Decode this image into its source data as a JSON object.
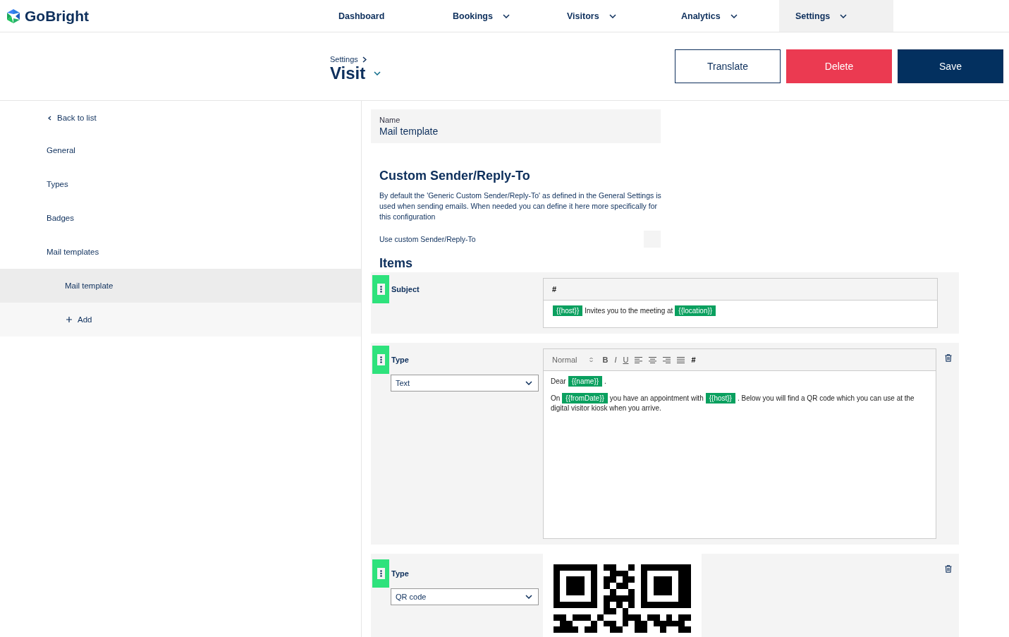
{
  "brand": {
    "name": "GoBright"
  },
  "nav": [
    {
      "label": "Dashboard",
      "dropdown": false,
      "selected": false
    },
    {
      "label": "Bookings",
      "dropdown": true,
      "selected": false
    },
    {
      "label": "Visitors",
      "dropdown": true,
      "selected": false
    },
    {
      "label": "Analytics",
      "dropdown": true,
      "selected": false
    },
    {
      "label": "Settings",
      "dropdown": true,
      "selected": true
    }
  ],
  "header": {
    "breadcrumb": "Settings",
    "title": "Visit",
    "buttons": [
      {
        "label": "Translate",
        "kind": "outline"
      },
      {
        "label": "Delete",
        "kind": "danger"
      },
      {
        "label": "Save",
        "kind": "primary"
      }
    ]
  },
  "sidebar": {
    "back": "Back to list",
    "items": [
      {
        "label": "General",
        "selected": false
      },
      {
        "label": "Types",
        "selected": false
      },
      {
        "label": "Badges",
        "selected": false
      },
      {
        "label": "Mail templates",
        "selected": false,
        "children": [
          {
            "label": "Mail template",
            "selected": true
          }
        ]
      }
    ],
    "add": "Add"
  },
  "name_field": {
    "label": "Name",
    "value": "Mail template"
  },
  "sender": {
    "heading": "Custom Sender/Reply-To",
    "description": "By default the 'Generic Custom Sender/Reply-To' as defined in the General Settings is used when sending emails. When needed you can define it here more specifically for this configuration",
    "toggle_label": "Use custom Sender/Reply-To",
    "checked": false
  },
  "items_heading": "Items",
  "items": [
    {
      "kind": "subject",
      "label": "Subject",
      "deletable": false,
      "toolbar": [
        {
          "kind": "hash",
          "label": "#"
        }
      ],
      "paragraphs": [
        [
          {
            "kind": "tag",
            "text": "{{host}}"
          },
          {
            "kind": "text",
            "text": "Invites you to the meeting at"
          },
          {
            "kind": "tag",
            "text": "{{location}}"
          }
        ]
      ]
    },
    {
      "kind": "text",
      "label": "Type",
      "select": "Text",
      "deletable": true,
      "format": "Normal",
      "toolbar": [
        {
          "kind": "bold",
          "label": "B"
        },
        {
          "kind": "italic",
          "label": "I"
        },
        {
          "kind": "underline",
          "label": "U"
        },
        {
          "kind": "align-left"
        },
        {
          "kind": "align-center"
        },
        {
          "kind": "align-right"
        },
        {
          "kind": "justify"
        },
        {
          "kind": "hash",
          "label": "#"
        }
      ],
      "paragraphs": [
        [
          {
            "kind": "text",
            "text": "Dear"
          },
          {
            "kind": "tag",
            "text": "{{name}}"
          },
          {
            "kind": "text",
            "text": "."
          }
        ],
        [
          {
            "kind": "text",
            "text": "On"
          },
          {
            "kind": "tag",
            "text": "{{fromDate}}"
          },
          {
            "kind": "text",
            "text": "you have an appointment with"
          },
          {
            "kind": "tag",
            "text": "{{host}}"
          },
          {
            "kind": "text",
            "text": ". Below you will find a QR code which you can use at the digital visitor kiosk when you arrive."
          }
        ]
      ]
    },
    {
      "kind": "qr",
      "label": "Type",
      "select": "QR code",
      "deletable": true
    }
  ]
}
